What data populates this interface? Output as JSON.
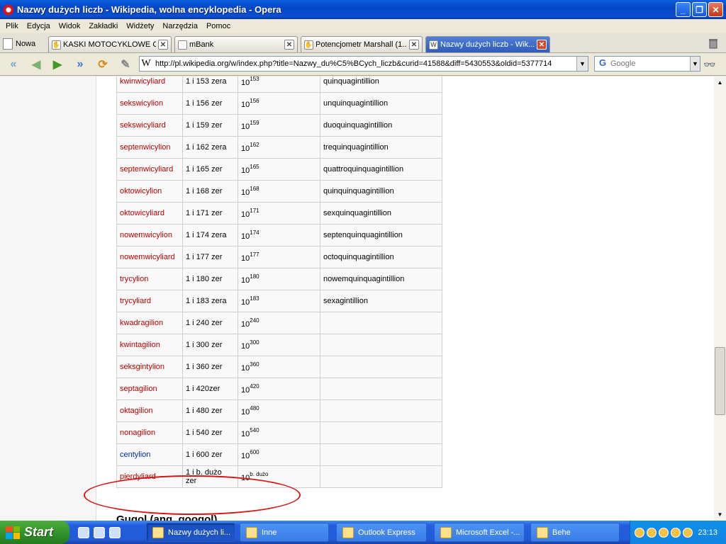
{
  "window": {
    "title": "Nazwy dużych liczb - Wikipedia, wolna encyklopedia - Opera"
  },
  "menu": [
    "Plik",
    "Edycja",
    "Widok",
    "Zakładki",
    "Widżety",
    "Narzędzia",
    "Pomoc"
  ],
  "tabs": {
    "new_label": "Nowa",
    "items": [
      {
        "label": "KASKI MOTOCYKLOWE C..."
      },
      {
        "label": "mBank"
      },
      {
        "label": "Potencjometr Marshall (1..."
      },
      {
        "label": "Nazwy dużych liczb - Wik..."
      }
    ]
  },
  "address": {
    "url": "http://pl.wikipedia.org/w/index.php?title=Nazwy_du%C5%BCych_liczb&curid=41588&diff=5430553&oldid=5377714",
    "search_placeholder": "Google"
  },
  "table": {
    "rows": [
      {
        "name": "kwinwicyliard",
        "zeros": "1 i 153 zera",
        "base": "10",
        "exp": "153",
        "english": "quinquagintillion",
        "link": "red"
      },
      {
        "name": "sekswicylion",
        "zeros": "1 i 156 zer",
        "base": "10",
        "exp": "156",
        "english": "unquinquagintillion",
        "link": "red"
      },
      {
        "name": "sekswicyliard",
        "zeros": "1 i 159 zer",
        "base": "10",
        "exp": "159",
        "english": "duoquinquagintillion",
        "link": "red"
      },
      {
        "name": "septenwicylion",
        "zeros": "1 i 162 zera",
        "base": "10",
        "exp": "162",
        "english": "trequinquagintillion",
        "link": "red"
      },
      {
        "name": "septenwicyliard",
        "zeros": "1 i 165 zer",
        "base": "10",
        "exp": "165",
        "english": "quattroquinquagintillion",
        "link": "red"
      },
      {
        "name": "oktowicylion",
        "zeros": "1 i 168 zer",
        "base": "10",
        "exp": "168",
        "english": "quinquinquagintillion",
        "link": "red"
      },
      {
        "name": "oktowicyliard",
        "zeros": "1 i 171 zer",
        "base": "10",
        "exp": "171",
        "english": "sexquinquagintillion",
        "link": "red"
      },
      {
        "name": "nowemwicylion",
        "zeros": "1 i 174 zera",
        "base": "10",
        "exp": "174",
        "english": "septenquinquagintillion",
        "link": "red"
      },
      {
        "name": "nowemwicyliard",
        "zeros": "1 i 177 zer",
        "base": "10",
        "exp": "177",
        "english": "octoquinquagintillion",
        "link": "red"
      },
      {
        "name": "trycylion",
        "zeros": "1 i 180 zer",
        "base": "10",
        "exp": "180",
        "english": "nowemquinquagintillion",
        "link": "red"
      },
      {
        "name": "trycyliard",
        "zeros": "1 i 183 zera",
        "base": "10",
        "exp": "183",
        "english": "sexagintillion",
        "link": "red"
      },
      {
        "name": "kwadragilion",
        "zeros": "1 i 240 zer",
        "base": "10",
        "exp": "240",
        "english": "",
        "link": "red"
      },
      {
        "name": "kwintagilion",
        "zeros": "1 i 300 zer",
        "base": "10",
        "exp": "300",
        "english": "",
        "link": "red"
      },
      {
        "name": "seksgintylion",
        "zeros": "1 i 360 zer",
        "base": "10",
        "exp": "360",
        "english": "",
        "link": "red"
      },
      {
        "name": "septagilion",
        "zeros": "1 i 420zer",
        "base": "10",
        "exp": "420",
        "english": "",
        "link": "red"
      },
      {
        "name": "oktagilion",
        "zeros": "1 i 480 zer",
        "base": "10",
        "exp": "480",
        "english": "",
        "link": "red"
      },
      {
        "name": "nonagilion",
        "zeros": "1 i 540 zer",
        "base": "10",
        "exp": "540",
        "english": "",
        "link": "red"
      },
      {
        "name": "centylion",
        "zeros": "1 i 600 zer",
        "base": "10",
        "exp": "600",
        "english": "",
        "link": "blue"
      },
      {
        "name": "pierdyliard",
        "zeros": "1 i b. dużo zer",
        "base": "10",
        "exp": "b. dużo",
        "english": "",
        "link": "red"
      }
    ]
  },
  "next_heading": "Gugol (ang. googol)",
  "taskbar": {
    "start_label": "Start",
    "items": [
      {
        "label": "Nazwy dużych li..."
      },
      {
        "label": "Inne"
      },
      {
        "label": "Outlook Express"
      },
      {
        "label": "Microsoft Excel -..."
      },
      {
        "label": "Behe"
      }
    ],
    "clock": "23:13"
  },
  "colors": {
    "redlink": "#ba0000",
    "bluelink": "#002bb8",
    "annotation": "#d81414"
  }
}
